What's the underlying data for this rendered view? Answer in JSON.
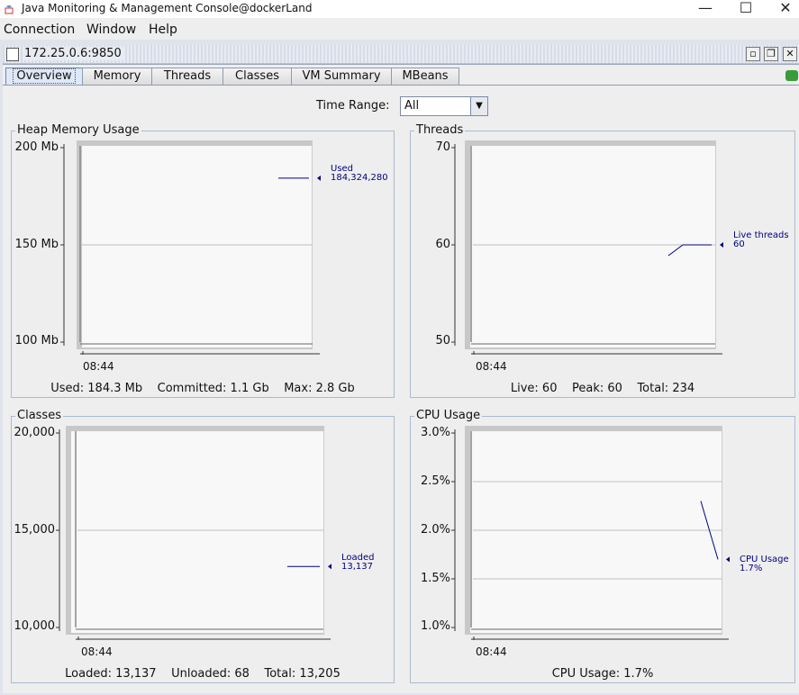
{
  "window": {
    "title": "Java Monitoring & Management Console@dockerLand",
    "minimize": "—",
    "maximize": "☐",
    "close": "✕"
  },
  "menu": {
    "items": [
      {
        "label": "Connection"
      },
      {
        "label": "Window"
      },
      {
        "label": "Help"
      }
    ]
  },
  "connection": {
    "address": "172.25.0.6:9850"
  },
  "tabs": [
    {
      "label": "Overview",
      "active": true
    },
    {
      "label": "Memory"
    },
    {
      "label": "Threads"
    },
    {
      "label": "Classes"
    },
    {
      "label": "VM Summary"
    },
    {
      "label": "MBeans"
    }
  ],
  "time_range": {
    "label": "Time Range:",
    "value": "All"
  },
  "charts": {
    "heap": {
      "title": "Heap Memory Usage",
      "y_ticks": [
        "200 Mb",
        "150 Mb",
        "100 Mb"
      ],
      "x_tick": "08:44",
      "series_label": "Used",
      "series_value": "184,324,280",
      "summary": "Used: 184.3 Mb    Committed: 1.1 Gb    Max: 2.8 Gb"
    },
    "threads": {
      "title": "Threads",
      "y_ticks": [
        "70",
        "60",
        "50"
      ],
      "x_tick": "08:44",
      "series_label": "Live threads",
      "series_value": "60",
      "summary": "Live: 60    Peak: 60    Total: 234"
    },
    "classes": {
      "title": "Classes",
      "y_ticks": [
        "20,000",
        "15,000",
        "10,000"
      ],
      "x_tick": "08:44",
      "series_label": "Loaded",
      "series_value": "13,137",
      "summary": "Loaded: 13,137    Unloaded: 68    Total: 13,205"
    },
    "cpu": {
      "title": "CPU Usage",
      "y_ticks": [
        "3.0%",
        "2.5%",
        "2.0%",
        "1.5%",
        "1.0%"
      ],
      "x_tick": "08:44",
      "series_label": "CPU Usage",
      "series_value": "1.7%",
      "summary": "CPU Usage: 1.7%"
    }
  },
  "chart_data": [
    {
      "type": "line",
      "title": "Heap Memory Usage",
      "x": [
        "08:44"
      ],
      "ylim": [
        100,
        200
      ],
      "unit": "Mb",
      "series": [
        {
          "name": "Used",
          "values": [
            184.3
          ]
        }
      ]
    },
    {
      "type": "line",
      "title": "Threads",
      "x": [
        "08:44"
      ],
      "ylim": [
        50,
        70
      ],
      "series": [
        {
          "name": "Live threads",
          "values": [
            60
          ]
        }
      ]
    },
    {
      "type": "line",
      "title": "Classes",
      "x": [
        "08:44"
      ],
      "ylim": [
        10000,
        20000
      ],
      "series": [
        {
          "name": "Loaded",
          "values": [
            13137
          ]
        }
      ]
    },
    {
      "type": "line",
      "title": "CPU Usage",
      "x": [
        "08:44"
      ],
      "ylim": [
        1.0,
        3.0
      ],
      "unit": "%",
      "series": [
        {
          "name": "CPU Usage",
          "values": [
            2.3,
            1.7
          ]
        }
      ]
    }
  ],
  "colors": {
    "series_line": "#00007f",
    "tab_active_bg": "#dfe8f6",
    "connection_icon": "#3a9b3a"
  }
}
